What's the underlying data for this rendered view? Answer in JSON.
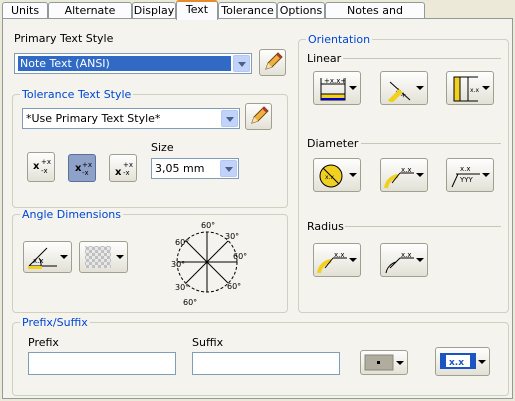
{
  "tabs": [
    "Units",
    "Alternate Units",
    "Display",
    "Text",
    "Tolerance",
    "Options",
    "Notes and Leaders"
  ],
  "primary_text_style": {
    "label": "Primary Text Style",
    "value": "Note Text (ANSI)"
  },
  "tolerance_text_style": {
    "group_title": "Tolerance Text Style",
    "value": "*Use Primary Text Style*",
    "size_label": "Size",
    "size_value": "3,05 mm"
  },
  "tolerance_glyphs": {
    "stack": "x",
    "sup": "+x",
    "sub": "-x"
  },
  "angle_dimensions": {
    "group_title": "Angle Dimensions",
    "angles": [
      "60°",
      "30°",
      "60°",
      "60°",
      "30°",
      "60°",
      "30°",
      "60°"
    ]
  },
  "orientation": {
    "group_title": "Orientation",
    "linear_label": "Linear",
    "diameter_label": "Diameter",
    "radius_label": "Radius"
  },
  "glyph_texts": {
    "xxx": "x.x",
    "yyy": "YYY",
    "plusx": "+x.x+"
  },
  "prefix_suffix": {
    "group_title": "Prefix/Suffix",
    "prefix_label": "Prefix",
    "suffix_label": "Suffix",
    "prefix_value": "",
    "suffix_value": ""
  },
  "colors": {
    "accent": "#0046d5",
    "active_tab_border": "#e68b2c",
    "selection": "#316ac5"
  }
}
